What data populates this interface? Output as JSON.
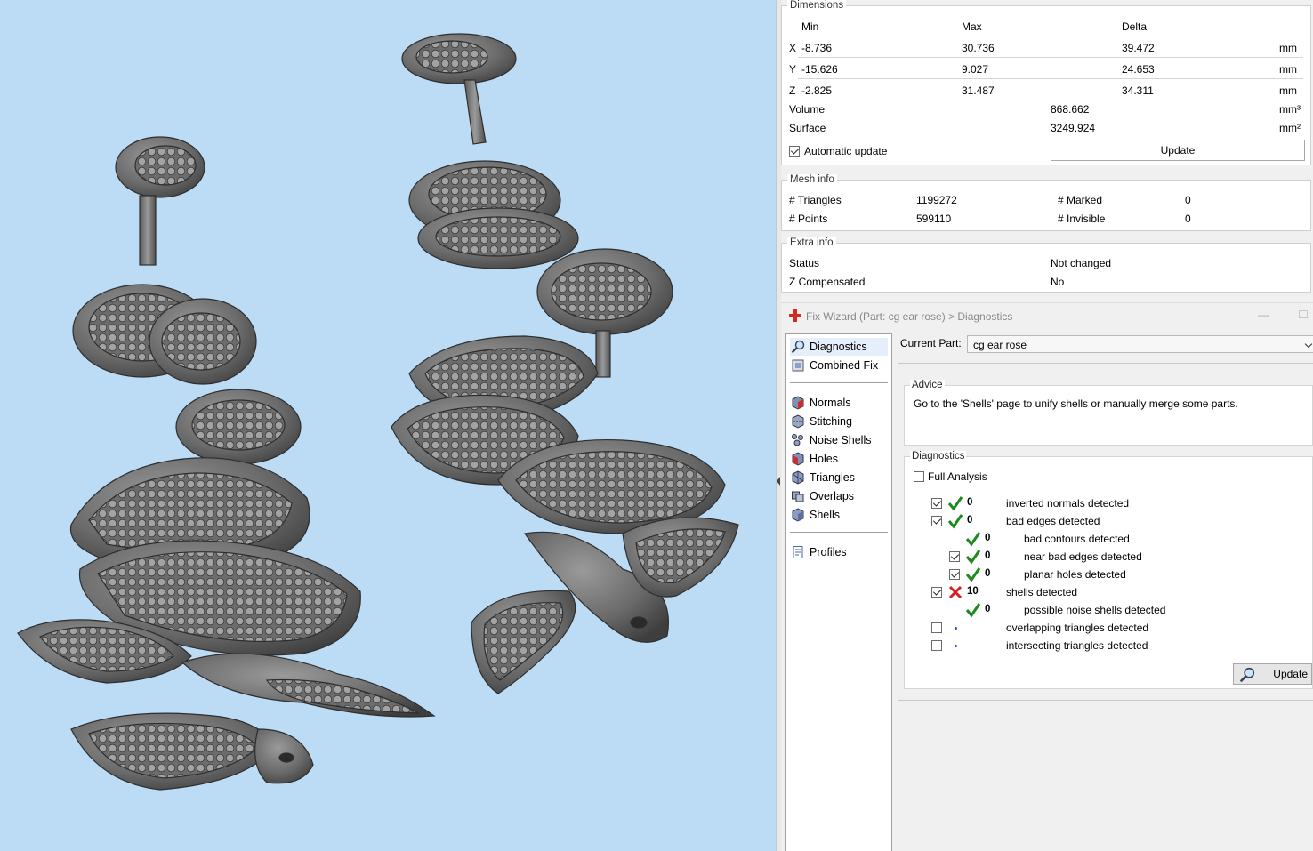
{
  "dimensions": {
    "title": "Dimensions",
    "headers": {
      "min": "Min",
      "max": "Max",
      "delta": "Delta"
    },
    "rows": [
      {
        "axis": "X",
        "min": "-8.736",
        "max": "30.736",
        "delta": "39.472",
        "unit": "mm"
      },
      {
        "axis": "Y",
        "min": "-15.626",
        "max": "9.027",
        "delta": "24.653",
        "unit": "mm"
      },
      {
        "axis": "Z",
        "min": "-2.825",
        "max": "31.487",
        "delta": "34.311",
        "unit": "mm"
      }
    ],
    "volume": {
      "label": "Volume",
      "value": "868.662",
      "unit": "mm³"
    },
    "surface": {
      "label": "Surface",
      "value": "3249.924",
      "unit": "mm²"
    },
    "auto_update": {
      "label": "Automatic update",
      "checked": true
    },
    "update_label": "Update"
  },
  "mesh_info": {
    "title": "Mesh info",
    "triangles_label": "# Triangles",
    "triangles": "1199272",
    "points_label": "# Points",
    "points": "599110",
    "marked_label": "# Marked",
    "marked": "0",
    "invisible_label": "# Invisible",
    "invisible": "0"
  },
  "extra_info": {
    "title": "Extra info",
    "status_label": "Status",
    "status": "Not changed",
    "zcomp_label": "Z Compensated",
    "zcomp": "No"
  },
  "wizard": {
    "title": "Fix Wizard (Part: cg ear rose) > Diagnostics",
    "nav_top": [
      {
        "label": "Diagnostics",
        "icon": "magnifier-icon",
        "selected": true
      },
      {
        "label": "Combined Fix",
        "icon": "combined-fix-icon"
      }
    ],
    "nav_tools": [
      {
        "label": "Normals",
        "icon": "normals-icon"
      },
      {
        "label": "Stitching",
        "icon": "stitching-icon"
      },
      {
        "label": "Noise Shells",
        "icon": "noise-shells-icon"
      },
      {
        "label": "Holes",
        "icon": "holes-icon"
      },
      {
        "label": "Triangles",
        "icon": "triangles-icon"
      },
      {
        "label": "Overlaps",
        "icon": "overlaps-icon"
      },
      {
        "label": "Shells",
        "icon": "shells-icon"
      }
    ],
    "nav_profiles": {
      "label": "Profiles",
      "icon": "profiles-icon"
    },
    "current_part_label": "Current Part:",
    "current_part": "cg ear rose",
    "advice_title": "Advice",
    "advice_text": "Go to the 'Shells' page to unify shells or manually merge some parts.",
    "diagnostics_title": "Diagnostics",
    "full_analysis": {
      "label": "Full Analysis",
      "checked": false
    },
    "checks": [
      {
        "checked": true,
        "status": "ok",
        "count": "0",
        "label": "inverted normals detected",
        "indent": 0
      },
      {
        "checked": true,
        "status": "ok",
        "count": "0",
        "label": "bad edges detected",
        "indent": 0
      },
      {
        "checked": null,
        "status": "ok",
        "count": "0",
        "label": "bad contours detected",
        "indent": 1
      },
      {
        "checked": true,
        "status": "ok",
        "count": "0",
        "label": "near bad edges detected",
        "indent": 1
      },
      {
        "checked": true,
        "status": "ok",
        "count": "0",
        "label": "planar holes detected",
        "indent": 1
      },
      {
        "checked": true,
        "status": "error",
        "count": "10",
        "label": "shells detected",
        "indent": 0
      },
      {
        "checked": null,
        "status": "ok",
        "count": "0",
        "label": "possible noise shells detected",
        "indent": 1
      },
      {
        "checked": false,
        "status": "pending",
        "count": "",
        "label": "overlapping triangles detected",
        "indent": 0
      },
      {
        "checked": false,
        "status": "pending",
        "count": "",
        "label": "intersecting triangles detected",
        "indent": 0
      }
    ],
    "update_label": "Update"
  },
  "colors": {
    "viewport_bg": "#bcdcf6",
    "model_gray": "#6e6e6e",
    "ok_green": "#1e8a1e",
    "error_red": "#d42020"
  }
}
